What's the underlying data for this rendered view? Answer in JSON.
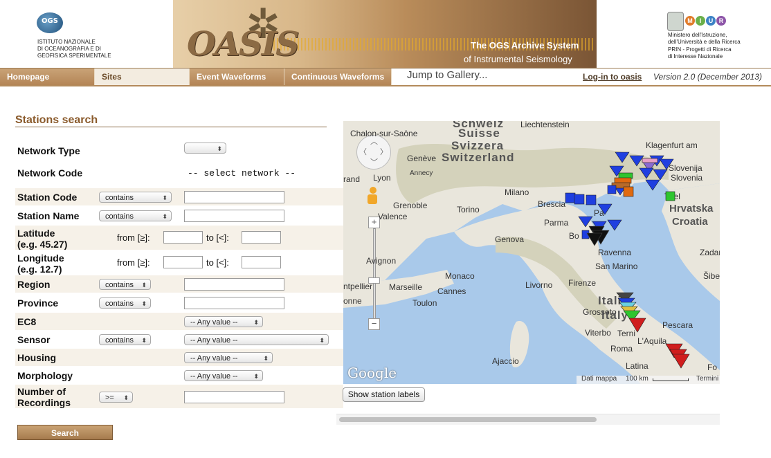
{
  "header": {
    "ogs_logo_abbr": "OGS",
    "ogs_line1": "ISTITUTO NAZIONALE",
    "ogs_line2": "DI OCEANOGRAFIA E DI",
    "ogs_line3": "GEOFISICA SPERIMENTALE",
    "banner_title": "OASIS",
    "banner_tagline1": "The OGS Archive System",
    "banner_tagline2": "of Instrumental Seismology",
    "miur_letters": [
      "M",
      "I",
      "U",
      "R"
    ],
    "miur_line1": "Ministero dell'Istruzione,",
    "miur_line2": "dell'Università e della Ricerca",
    "miur_line3": "PRIN - Progetti di Ricerca",
    "miur_line4": "di Interesse Nazionale"
  },
  "nav": {
    "tabs": [
      "Homepage",
      "Sites",
      "Event Waveforms",
      "Continuous Waveforms"
    ],
    "active_tab": "Sites",
    "gallery_link": "Jump to Gallery...",
    "login_link": "Log-in to oasis",
    "version": "Version 2.0 (December 2013)"
  },
  "search": {
    "title": "Stations search",
    "network_type": {
      "label": "Network Type",
      "value": ""
    },
    "network_code": {
      "label": "Network Code",
      "value": "-- select network --"
    },
    "station_code": {
      "label": "Station Code",
      "operator": "contains",
      "value": ""
    },
    "station_name": {
      "label": "Station Name",
      "operator": "contains",
      "value": ""
    },
    "latitude": {
      "label": "Latitude",
      "hint": "(e.g. 45.27)",
      "from_label": "from [≥]:",
      "to_label": "to [<]:"
    },
    "longitude": {
      "label": "Longitude",
      "hint": "(e.g. 12.7)",
      "from_label": "from [≥]:",
      "to_label": "to [<]:"
    },
    "region": {
      "label": "Region",
      "operator": "contains",
      "value": ""
    },
    "province": {
      "label": "Province",
      "operator": "contains",
      "value": ""
    },
    "ec8": {
      "label": "EC8",
      "value": "-- Any value --"
    },
    "sensor": {
      "label": "Sensor",
      "operator": "contains",
      "value": "-- Any value --"
    },
    "housing": {
      "label": "Housing",
      "value": "-- Any value --"
    },
    "morphology": {
      "label": "Morphology",
      "value": "-- Any value --"
    },
    "recordings": {
      "label_line1": "Number of",
      "label_line2": "Recordings",
      "operator": ">=",
      "value": ""
    },
    "search_button": "Search"
  },
  "map": {
    "labels": {
      "schweiz": "Schweiz",
      "suisse": "Suisse",
      "svizzera": "Svizzera",
      "switzerland": "Switzerland",
      "liechtenstein": "Liechtenstein",
      "chalon": "Chalon-sur-Saône",
      "klagenfurt": "Klagenfurt am",
      "slovenija": "Slovenija",
      "slovenia": "Slovenia",
      "geneve": "Genève",
      "annecy": "Annecy",
      "lyon": "Lyon",
      "rand": "rand",
      "milano": "Milano",
      "brescia": "Brescia",
      "grenoble": "Grenoble",
      "torino": "Torino",
      "parma": "Parma",
      "valence": "Valence",
      "genova": "Genova",
      "trieste": "Triel",
      "hrvatska": "Hrvatska",
      "croatia": "Croatia",
      "ravenna": "Ravenna",
      "san_marino": "San Marino",
      "zadar": "Zadar",
      "avignon": "Avignon",
      "montpellier": "ntpellier",
      "marseille": "Marseille",
      "monaco": "Monaco",
      "cannes": "Cannes",
      "livorno": "Livorno",
      "firenze": "Firenze",
      "toulon": "Toulon",
      "onne": "onne",
      "italia1": "Italia",
      "italia2": "Italy",
      "grosseto": "Grosseto",
      "pescara": "Pescara",
      "viterbo": "Viterbo",
      "terni": "Terni",
      "laquila": "L'Aquila",
      "roma": "Roma",
      "ajaccio": "Ajaccio",
      "latina": "Latina",
      "fo": "Fo",
      "sibe": "Šibe",
      "bo": "Bo",
      "pa": "Pa"
    },
    "google": "Google",
    "attribution": "Dati mappa",
    "scale": "100 km",
    "terms": "Termini",
    "zoom_in": "+",
    "zoom_out": "−",
    "colors": {
      "sea": "#a9c9ea",
      "land": "#e9e6dc",
      "mountains": "#d4d2bb",
      "blue_station": "#1f3fe0",
      "red_station": "#d01e1e",
      "black_station": "#111111",
      "green_station": "#2ec52e",
      "orange_station": "#e06a10"
    }
  },
  "show_labels_button": "Show station labels"
}
